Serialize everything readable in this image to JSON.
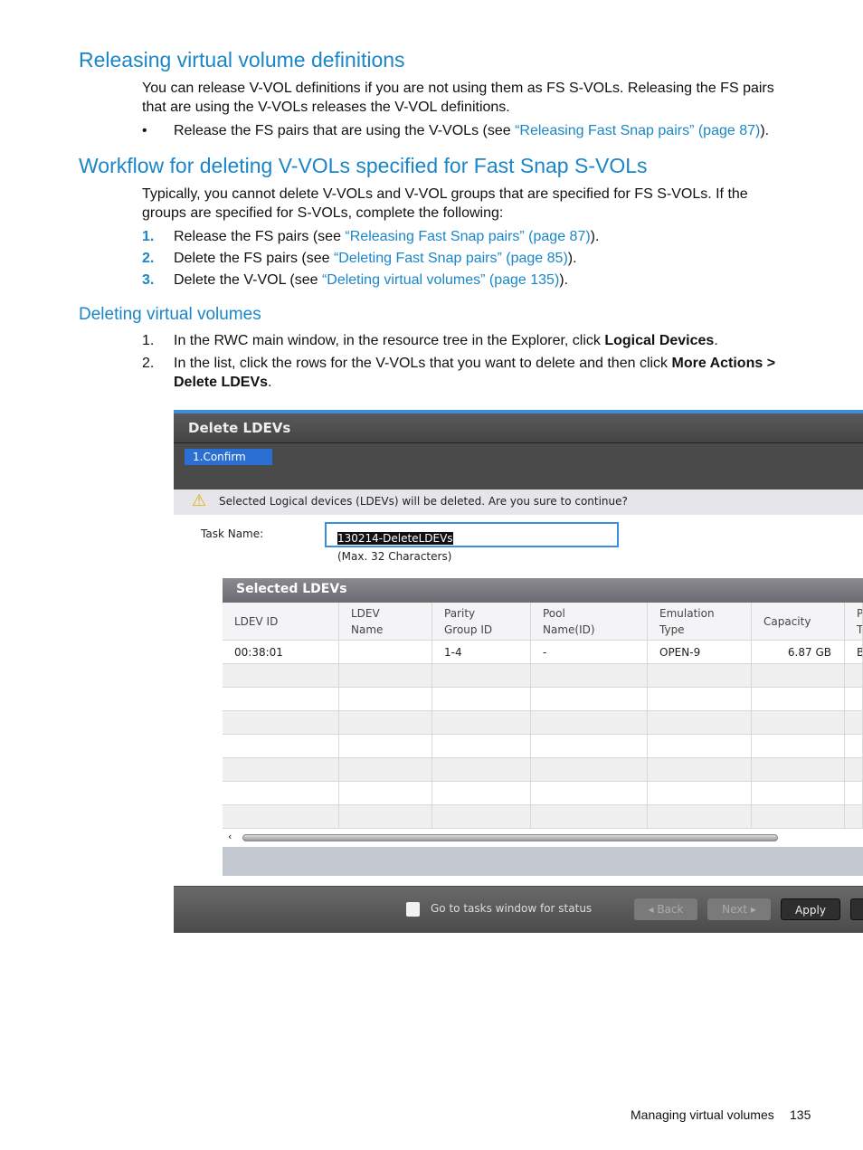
{
  "sections": [
    {
      "title": "Releasing virtual volume definitions",
      "para": [
        "You can release V-VOL definitions if you are not using them as FS S-VOLs. Releasing the FS pairs",
        "that are using the V-VOLs releases the V-VOL definitions."
      ],
      "bullet": {
        "mark": "•",
        "pre": "Release the FS pairs that are using the V-VOLs (see ",
        "link": "“Releasing Fast Snap pairs” (page 87)",
        "post": ")."
      }
    },
    {
      "title": "Workflow for deleting V-VOLs specified for Fast Snap S-VOLs",
      "para": [
        "Typically, you cannot delete V-VOLs and V-VOL groups that are specified for FS S-VOLs. If the",
        "groups are specified for S-VOLs, complete the following:"
      ],
      "steps": [
        {
          "num": "1.",
          "pre": "Release the FS pairs (see ",
          "link": "“Releasing Fast Snap pairs” (page 87)",
          "post": ")."
        },
        {
          "num": "2.",
          "pre": "Delete the FS pairs (see ",
          "link": "“Deleting Fast Snap pairs” (page 85)",
          "post": ")."
        },
        {
          "num": "3.",
          "pre": "Delete the V-VOL (see ",
          "link": "“Deleting virtual volumes” (page 135)",
          "post": ")."
        }
      ]
    },
    {
      "title": "Deleting virtual volumes",
      "steps": [
        {
          "num": "1.",
          "pre": "In the RWC main window, in the resource tree in the Explorer, click ",
          "bold": "Logical Devices",
          "post": "."
        },
        {
          "num": "2.",
          "pre": "In the list, click the rows for the V-VOLs that you want to delete and then click ",
          "bold": "More Actions >",
          "line2bold": "Delete LDEVs",
          "post": "."
        }
      ]
    }
  ],
  "dialog": {
    "title": "Delete LDEVs",
    "step": "1.Confirm",
    "warning": "Selected Logical devices (LDEVs) will be deleted. Are you sure to continue?",
    "task_label": "Task Name:",
    "task_value": "130214-DeleteLDEVs",
    "task_hint": "(Max. 32 Characters)",
    "table_title": "Selected LDEVs",
    "columns": [
      "LDEV ID",
      "LDEV\nName",
      "Parity\nGroup ID",
      "Pool\nName(ID)",
      "Emulation\nType",
      "Capacity",
      "P\nT"
    ],
    "rows": [
      [
        "00:38:01",
        "",
        "1-4",
        "-",
        "OPEN-9",
        "6.87 GB",
        "B"
      ]
    ],
    "checkbox_label": "Go to tasks window for status",
    "back": "Back",
    "next": "Next",
    "apply": "Apply"
  },
  "footer": {
    "section": "Managing virtual volumes",
    "page": "135"
  },
  "colors": {
    "heading": "#1a86c8",
    "dialog_bg": "#4a4a4a",
    "step_tab": "#2a6fd1"
  }
}
